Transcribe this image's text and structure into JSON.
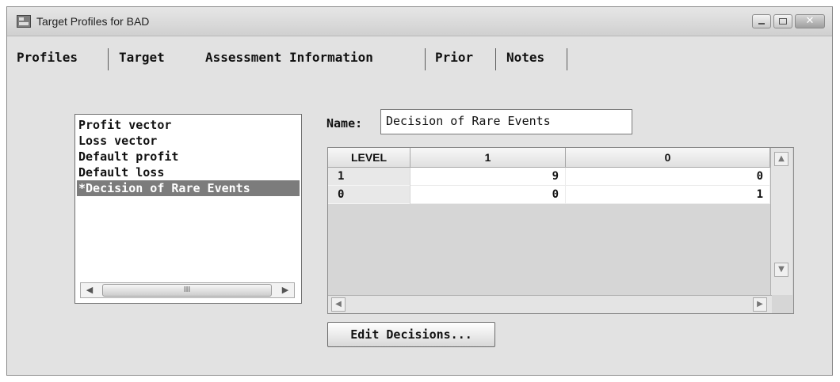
{
  "window": {
    "title": "Target Profiles for BAD"
  },
  "tabs": [
    {
      "label": "Profiles"
    },
    {
      "label": "Target"
    },
    {
      "label": "Assessment Information"
    },
    {
      "label": "Prior"
    },
    {
      "label": "Notes"
    }
  ],
  "active_tab": "Assessment Information",
  "matrix_list": {
    "items": [
      "Profit vector",
      "Loss vector",
      "Default profit",
      "Default loss",
      "*Decision of Rare Events"
    ],
    "selected_index": 4,
    "scroll_grip": "III"
  },
  "name_field": {
    "label": "Name:",
    "value": "Decision of Rare Events"
  },
  "decision_table": {
    "headers": [
      "LEVEL",
      "1",
      "0"
    ],
    "rows": [
      {
        "level": "1",
        "values": [
          "9",
          "0"
        ]
      },
      {
        "level": "0",
        "values": [
          "0",
          "1"
        ]
      }
    ]
  },
  "buttons": {
    "edit_decisions": "Edit Decisions..."
  },
  "icons": {
    "up": "▲",
    "down": "▼",
    "left": "◀",
    "right": "▶",
    "close": "✕"
  },
  "colors": {
    "selection": "#7c7c7c",
    "window_bg": "#e2e2e2"
  }
}
